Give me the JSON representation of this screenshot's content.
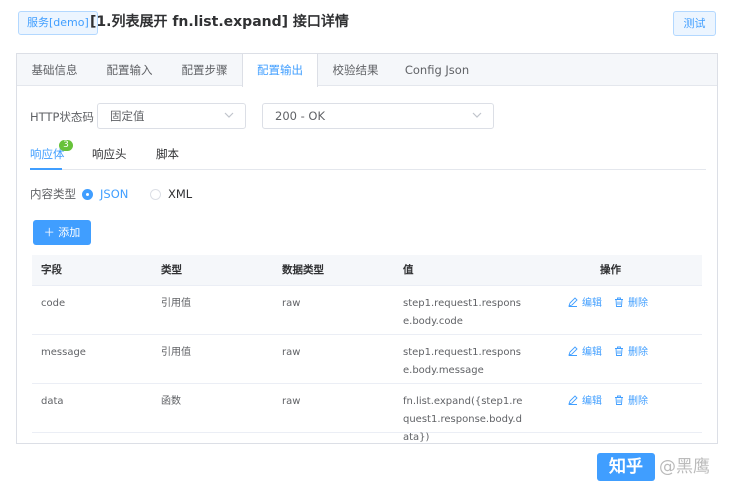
{
  "header": {
    "service_tag": "服务[demo]",
    "title": "[1.列表展开 fn.list.expand] 接口详情",
    "test_button": "测试"
  },
  "tabs": [
    {
      "label": "基础信息",
      "active": false
    },
    {
      "label": "配置输入",
      "active": false
    },
    {
      "label": "配置步骤",
      "active": false
    },
    {
      "label": "配置输出",
      "active": true
    },
    {
      "label": "校验结果",
      "active": false
    },
    {
      "label": "Config Json",
      "active": false
    }
  ],
  "status": {
    "label": "HTTP状态码",
    "mode_value": "固定值",
    "code_value": "200 - OK"
  },
  "subtabs": {
    "body": "响应体",
    "body_badge": "3",
    "headers": "响应头",
    "script": "脚本"
  },
  "content_type": {
    "label": "内容类型",
    "json": "JSON",
    "xml": "XML",
    "selected": "JSON"
  },
  "add_button": "添加",
  "table": {
    "headers": [
      "字段",
      "类型",
      "数据类型",
      "值",
      "操作"
    ],
    "rows": [
      {
        "field": "code",
        "type": "引用值",
        "data_type": "raw",
        "value": "step1.request1.response.body.code"
      },
      {
        "field": "message",
        "type": "引用值",
        "data_type": "raw",
        "value": "step1.request1.response.body.message"
      },
      {
        "field": "data",
        "type": "函数",
        "data_type": "raw",
        "value": "fn.list.expand({step1.request1.response.body.data})"
      }
    ],
    "edit_label": "编辑",
    "delete_label": "删除"
  },
  "watermark": {
    "logo": "知乎",
    "author": "@黑鹰"
  },
  "colors": {
    "accent": "#409eff",
    "badge": "#67c23a"
  }
}
